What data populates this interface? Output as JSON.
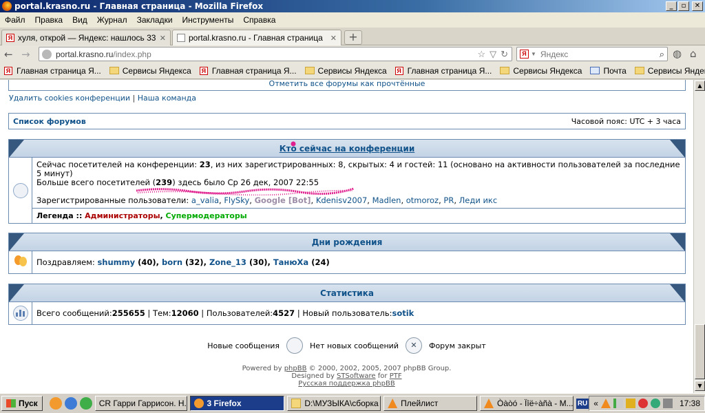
{
  "window": {
    "title": "portal.krasno.ru - Главная страница - Mozilla Firefox",
    "min": "_",
    "max": "▫",
    "close": "✕"
  },
  "menu": [
    "Файл",
    "Правка",
    "Вид",
    "Журнал",
    "Закладки",
    "Инструменты",
    "Справка"
  ],
  "tabs": [
    {
      "label": "хуля, открой — Яндекс: нашлось 333 ...",
      "close": "✕"
    },
    {
      "label": "portal.krasno.ru - Главная страница",
      "close": "✕"
    }
  ],
  "newtab": "+",
  "nav": {
    "back": "←",
    "forward": "→",
    "url_host": "portal.krasno.ru",
    "url_path": "/index.php",
    "star": "☆",
    "dropdown": "▽",
    "reload": "↻",
    "search_placeholder": "Яндекс",
    "search_icon": "magnifier-icon"
  },
  "bookmarks": [
    {
      "type": "yandex",
      "label": "Главная страница Я..."
    },
    {
      "type": "folder",
      "label": "Сервисы Яндекса"
    },
    {
      "type": "yandex",
      "label": "Главная страница Я..."
    },
    {
      "type": "folder",
      "label": "Сервисы Яндекса"
    },
    {
      "type": "yandex",
      "label": "Главная страница Я..."
    },
    {
      "type": "folder",
      "label": "Сервисы Яндекса"
    },
    {
      "type": "mail",
      "label": "Почта"
    },
    {
      "type": "folder",
      "label": "Сервисы Яндекса"
    }
  ],
  "bookmarks_more": "»",
  "forum": {
    "mark_read": "Отметить все форумы как прочтённые",
    "delete_cookies": "Удалить cookies конференции",
    "team": "Наша команда",
    "separator": "|",
    "forum_list": "Список форумов",
    "timezone": "Часовой пояс: UTC + 3 часа",
    "online": {
      "title": "Кто сейчас на конференции",
      "line1_pre": "Сейчас посетителей на конференции: ",
      "line1_total": "23",
      "line1_post": ", из них зарегистрированных: 8, скрытых: 4 и гостей: 11 (основано на активности пользователей за последние 5 минут)",
      "line2_pre": "Больше всего посетителей (",
      "line2_num": "239",
      "line2_post": ") здесь было Ср 26 дек, 2007 22:55",
      "registered_label": "Зарегистрированные пользователи: ",
      "users": [
        "a_valia",
        "FlySky",
        "Google [Bot]",
        "Kdenisv2007",
        "Madlen",
        "otmoroz",
        "PR",
        "Леди икс"
      ],
      "legend_label": "Легенда :: ",
      "legend_admin": "Администраторы",
      "legend_smod": "Супермодераторы"
    },
    "birthdays": {
      "title": "Дни рождения",
      "label": "Поздравляем: ",
      "people": [
        {
          "name": "shummy",
          "age": "(40)"
        },
        {
          "name": "born",
          "age": "(32)"
        },
        {
          "name": "Zone_13",
          "age": "(30)"
        },
        {
          "name": "ТанюХа",
          "age": "(24)"
        }
      ]
    },
    "stats": {
      "title": "Статистика",
      "posts_label": "Всего сообщений: ",
      "posts": "255655",
      "topics_label": "Тем: ",
      "topics": "12060",
      "users_label": "Пользователей: ",
      "users": "4527",
      "newest_label": "Новый пользователь: ",
      "newest": "sotik"
    },
    "legend_icons": {
      "new": "Новые сообщения",
      "no_new": "Нет новых сообщений",
      "locked": "Форум закрыт"
    },
    "footer": {
      "powered_pre": "Powered by ",
      "phpbb": "phpBB",
      "powered_post": " © 2000, 2002, 2005, 2007 phpBB Group.",
      "designed_pre": "Designed by ",
      "sts": "STSoftware",
      "designed_mid": " for ",
      "ptf": "PTF",
      "russian": "Русская поддержка phpBB"
    }
  },
  "taskbar": {
    "start": "Пуск",
    "items": [
      {
        "label": "CR Гарри Гаррисон. Н...",
        "active": false
      },
      {
        "label": "3 Firefox",
        "active": true
      },
      {
        "label": "D:\\МУЗЫКА\\сборка",
        "active": false
      },
      {
        "label": "Плейлист",
        "active": false
      },
      {
        "label": "Òàòó - Ïîë÷àñà - M...",
        "active": false
      }
    ],
    "lang": "RU",
    "tray_more": "«",
    "clock": "17:38"
  },
  "colors": {
    "link": "#105289",
    "admin": "#aa0000",
    "smod": "#00aa00",
    "bot": "#9e8da7",
    "scribble": "#e0208e"
  }
}
